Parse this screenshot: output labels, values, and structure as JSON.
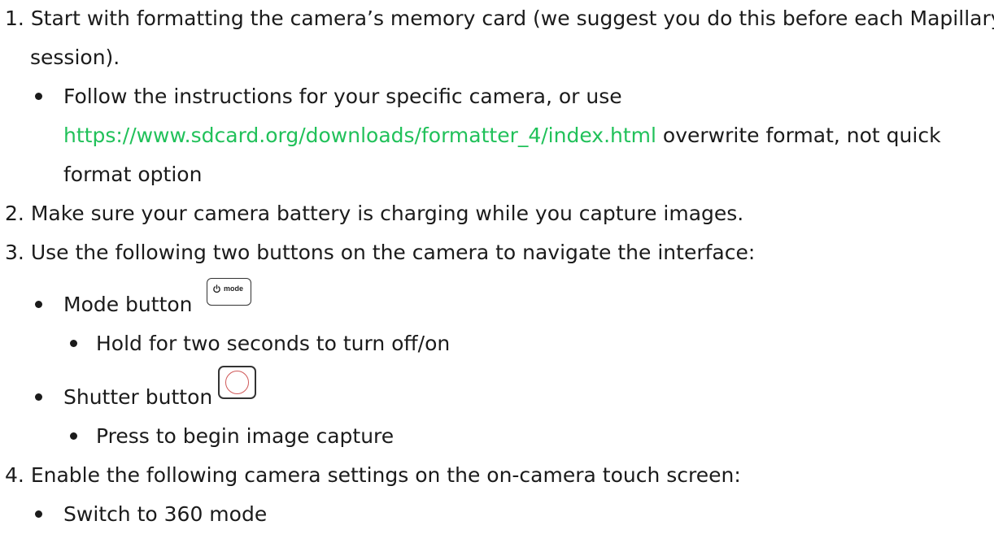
{
  "steps": {
    "s1": {
      "number": "1.",
      "line1": "Start with formatting the camera’s memory card (we suggest you do this before each Mapillary",
      "line2": "session).",
      "sub1": {
        "line1": "Follow the instructions for your specific camera, or use",
        "link": "https://www.sdcard.org/downloads/formatter_4/index.html",
        "after_link": " overwrite format, not quick",
        "line3": "format option"
      }
    },
    "s2": {
      "number": "2.",
      "text": "Make sure your camera battery is charging while you capture images."
    },
    "s3": {
      "number": "3.",
      "text": "Use the following two buttons on the camera to navigate the interface:",
      "mode": {
        "label": "Mode button",
        "icon_text": "mode",
        "sub": "Hold for two seconds to turn off/on"
      },
      "shutter": {
        "label": "Shutter button",
        "sub": "Press to begin image capture"
      }
    },
    "s4": {
      "number": "4.",
      "text": "Enable the following camera settings on the on-camera touch screen:",
      "sub1": "Switch to 360 mode"
    }
  },
  "colors": {
    "link": "#21c15a",
    "text": "#1b1b1b",
    "shutter_ring": "#d05a5a"
  },
  "icons": [
    "power-mode-button-icon",
    "shutter-button-icon"
  ]
}
